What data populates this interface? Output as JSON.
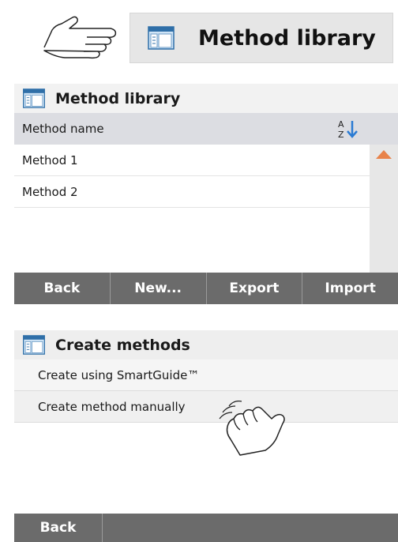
{
  "key_button": {
    "label": "Method library",
    "icon": "method-library-icon"
  },
  "method_library": {
    "title": "Method library",
    "column_header": "Method name",
    "rows": [
      "Method 1",
      "Method 2"
    ],
    "buttons": [
      "Back",
      "New...",
      "Export",
      "Import"
    ]
  },
  "create_methods": {
    "title": "Create methods",
    "options": [
      "Create using SmartGuide™",
      "Create method manually"
    ],
    "buttons": [
      "Back"
    ]
  },
  "colors": {
    "accent_arrow": "#e8834a",
    "button_bar": "#6b6b6b",
    "header_bg": "#dcdde2"
  }
}
